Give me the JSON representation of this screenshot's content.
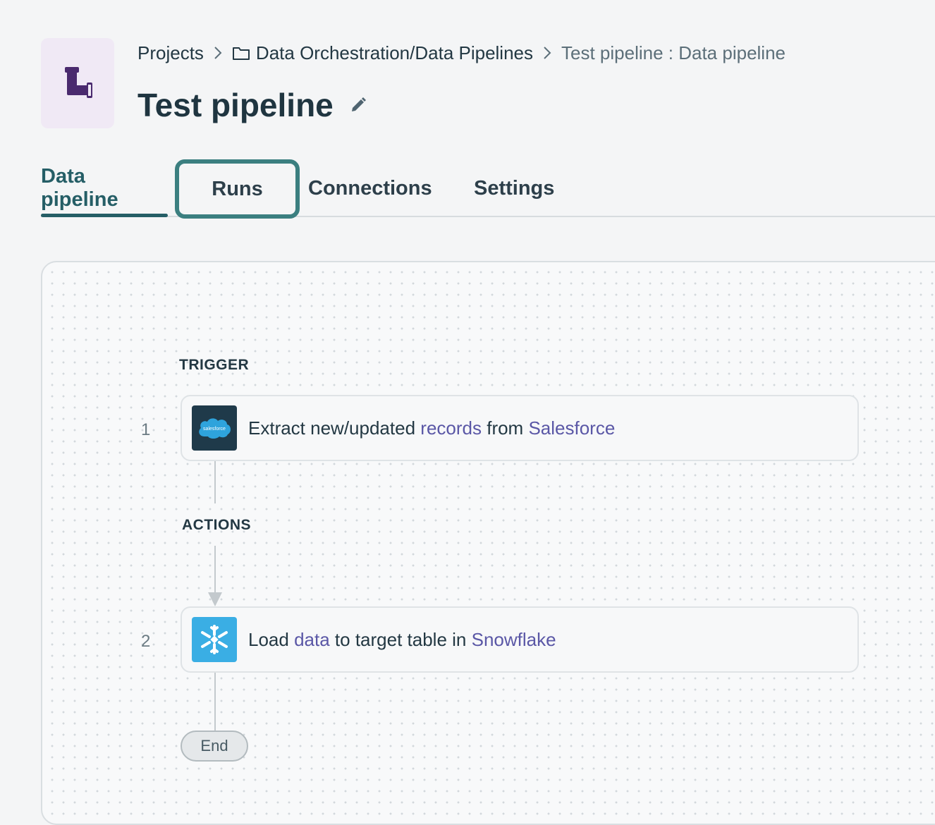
{
  "app": {
    "icon": "pipe-icon"
  },
  "breadcrumb": {
    "items": [
      {
        "label": "Projects"
      },
      {
        "label": "Data Orchestration/Data Pipelines",
        "icon": "folder-icon"
      },
      {
        "label": "Test pipeline : Data pipeline"
      }
    ]
  },
  "page": {
    "title": "Test pipeline",
    "edit_icon": "pencil-icon"
  },
  "tabs": [
    {
      "label": "Data pipeline",
      "active": true
    },
    {
      "label": "Runs",
      "highlighted": true
    },
    {
      "label": "Connections"
    },
    {
      "label": "Settings"
    }
  ],
  "pipeline": {
    "trigger_label": "TRIGGER",
    "actions_label": "ACTIONS",
    "steps": [
      {
        "number": "1",
        "icon": "salesforce-icon",
        "icon_text": "salesforce",
        "parts": [
          "Extract new/updated",
          "records",
          "from",
          "Salesforce"
        ]
      },
      {
        "number": "2",
        "icon": "snowflake-icon",
        "parts": [
          "Load",
          "data",
          "to target table in",
          "Snowflake"
        ]
      }
    ],
    "end_label": "End"
  },
  "colors": {
    "accent": "#255e66",
    "highlight": "#3b7f80",
    "link": "#5a57a6",
    "app_tile": "#f0e9f5",
    "app_icon": "#4a2a6e",
    "salesforce_tile": "#1f3a4a",
    "snowflake_tile": "#3aaee4"
  }
}
